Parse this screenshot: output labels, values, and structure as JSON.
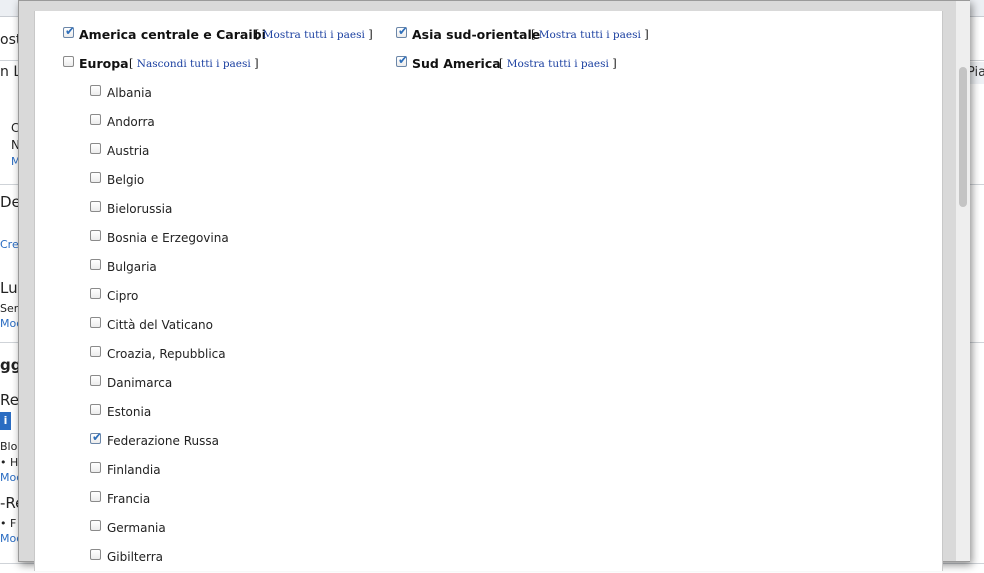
{
  "background": {
    "fragments": [
      {
        "id": "bg-ost",
        "text": "ost"
      },
      {
        "id": "bg-nl",
        "text": "n L"
      },
      {
        "id": "bg-c",
        "text": "C"
      },
      {
        "id": "bg-n",
        "text": "N"
      },
      {
        "id": "bg-m",
        "text": "M"
      },
      {
        "id": "bg-des",
        "text": "Des"
      },
      {
        "id": "bg-crea",
        "text": "Crea"
      },
      {
        "id": "bg-luo",
        "text": "Luo"
      },
      {
        "id": "bg-serv",
        "text": "Serv"
      },
      {
        "id": "bg-mod1",
        "text": "Mod"
      },
      {
        "id": "bg-ggi",
        "text": "ggi"
      },
      {
        "id": "bg-rec",
        "text": "Rec"
      },
      {
        "id": "bg-bloc",
        "text": "Bloc"
      },
      {
        "id": "bg-h",
        "text": "• H"
      },
      {
        "id": "bg-mod2",
        "text": "Mod"
      },
      {
        "id": "bg-re",
        "text": "-Re"
      },
      {
        "id": "bg-f",
        "text": "• F"
      },
      {
        "id": "bg-mod3",
        "text": "Mod"
      }
    ],
    "right_tab": "Pia",
    "badge": "i"
  },
  "regions": [
    {
      "name": "America centrale e Caraibi",
      "checked": true,
      "toggle": "Mostra tutti i paesi"
    },
    {
      "name": "Asia sud-orientale",
      "checked": true,
      "toggle": "Mostra tutti i paesi"
    },
    {
      "name": "Europa",
      "checked": false,
      "toggle": "Nascondi tutti i paesi"
    },
    {
      "name": "Sud America",
      "checked": true,
      "toggle": "Mostra tutti i paesi"
    }
  ],
  "countries": [
    {
      "name": "Albania",
      "checked": false
    },
    {
      "name": "Andorra",
      "checked": false
    },
    {
      "name": "Austria",
      "checked": false
    },
    {
      "name": "Belgio",
      "checked": false
    },
    {
      "name": "Bielorussia",
      "checked": false
    },
    {
      "name": "Bosnia e Erzegovina",
      "checked": false
    },
    {
      "name": "Bulgaria",
      "checked": false
    },
    {
      "name": "Cipro",
      "checked": false
    },
    {
      "name": "Città del Vaticano",
      "checked": false
    },
    {
      "name": "Croazia, Repubblica",
      "checked": false
    },
    {
      "name": "Danimarca",
      "checked": false
    },
    {
      "name": "Estonia",
      "checked": false
    },
    {
      "name": "Federazione Russa",
      "checked": true
    },
    {
      "name": "Finlandia",
      "checked": false
    },
    {
      "name": "Francia",
      "checked": false
    },
    {
      "name": "Germania",
      "checked": false
    },
    {
      "name": "Gibilterra",
      "checked": false
    }
  ],
  "colors": {
    "link": "#1a3fa0",
    "check": "#2f6fba"
  }
}
